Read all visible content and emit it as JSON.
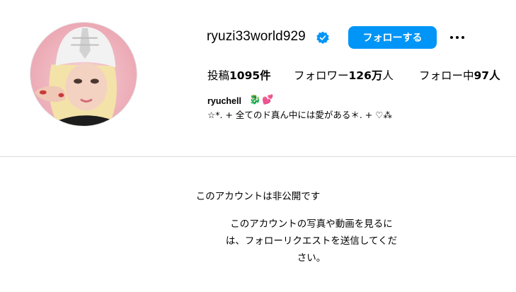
{
  "profile": {
    "username": "ryuzi33world929",
    "verified_icon": "verified-badge-icon",
    "follow_label": "フォローする",
    "more_icon": "more-options-icon",
    "accent_color": "#0095f6"
  },
  "stats": {
    "posts_label": "投稿",
    "posts_value": "1095件",
    "followers_label": "フォロワー",
    "followers_value": "126万",
    "followers_suffix": "人",
    "following_label": "フォロー中",
    "following_value": "97人"
  },
  "bio": {
    "name": "ryuchell",
    "emoji_1": "🐉",
    "emoji_2": "💕",
    "text": "☆*. + 全てのド真ん中には愛がある＊. + ♡⁂"
  },
  "private": {
    "title": "このアカウントは非公開です",
    "description": "このアカウントの写真や動画を見るには、フォローリクエストを送信してください。"
  }
}
